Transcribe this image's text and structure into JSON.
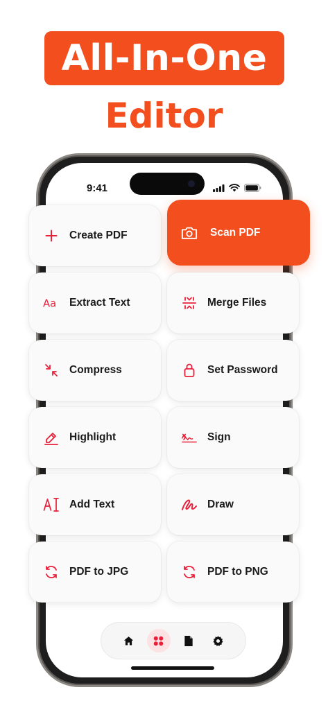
{
  "headline": {
    "line1": "All-In-One",
    "line2": "Editor"
  },
  "status_bar": {
    "time": "9:41"
  },
  "tools": [
    {
      "id": "create-pdf",
      "label": "Create PDF",
      "icon": "plus-icon"
    },
    {
      "id": "scan-pdf",
      "label": "Scan PDF",
      "icon": "camera-icon",
      "featured": true
    },
    {
      "id": "extract-text",
      "label": "Extract Text",
      "icon": "text-aa-icon"
    },
    {
      "id": "merge-files",
      "label": "Merge Files",
      "icon": "merge-icon"
    },
    {
      "id": "compress",
      "label": "Compress",
      "icon": "compress-icon"
    },
    {
      "id": "set-password",
      "label": "Set Password",
      "icon": "lock-icon"
    },
    {
      "id": "highlight",
      "label": "Highlight",
      "icon": "highlighter-icon"
    },
    {
      "id": "sign",
      "label": "Sign",
      "icon": "signature-icon"
    },
    {
      "id": "add-text",
      "label": "Add Text",
      "icon": "text-cursor-icon"
    },
    {
      "id": "draw",
      "label": "Draw",
      "icon": "scribble-icon"
    },
    {
      "id": "pdf-to-jpg",
      "label": "PDF to JPG",
      "icon": "convert-icon"
    },
    {
      "id": "pdf-to-png",
      "label": "PDF to PNG",
      "icon": "convert-icon"
    }
  ],
  "tab_bar": {
    "tabs": [
      {
        "icon": "home-icon",
        "active": false
      },
      {
        "icon": "grid-icon",
        "active": true
      },
      {
        "icon": "document-icon",
        "active": false
      },
      {
        "icon": "gear-icon",
        "active": false
      }
    ]
  },
  "colors": {
    "brand": "#F24E1E",
    "icon_red": "#E8203A",
    "card_bg": "#FAFAFA"
  }
}
